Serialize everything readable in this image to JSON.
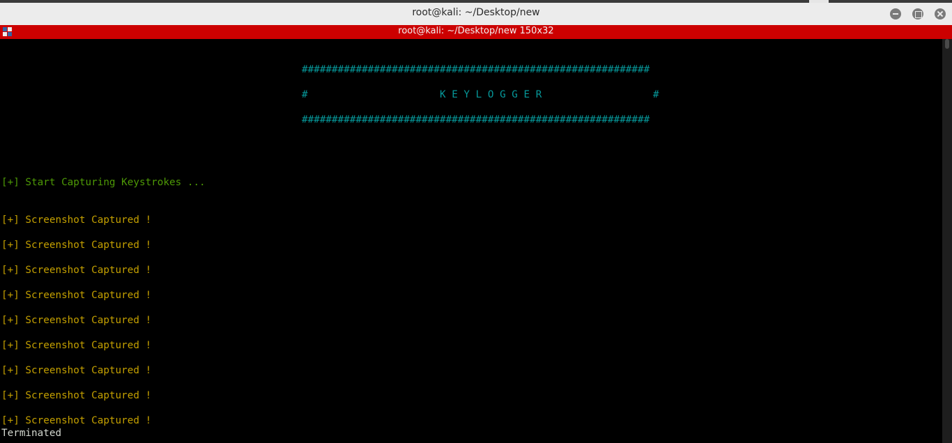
{
  "window": {
    "title": "root@kali: ~/Desktop/new",
    "tab_title": "root@kali: ~/Desktop/new 150x32"
  },
  "terminal": {
    "banner": {
      "top": "##########################################################",
      "left_hash": "#",
      "title": "K E Y L O G G E R",
      "right_hash": "#",
      "bottom": "##########################################################"
    },
    "start_line": "[+] Start Capturing Keystrokes ...",
    "captures": [
      "[+] Screenshot Captured !",
      "[+] Screenshot Captured !",
      "[+] Screenshot Captured !",
      "[+] Screenshot Captured !",
      "[+] Screenshot Captured !",
      "[+] Screenshot Captured !",
      "[+] Screenshot Captured !",
      "[+] Screenshot Captured !",
      "[+] Screenshot Captured !"
    ],
    "terminated": "Terminated"
  },
  "colors": {
    "tab_bar": "#cc0000",
    "banner": "#06989a",
    "start_line": "#4e9a06",
    "capture_line": "#c4a000"
  },
  "icons": {
    "terminal_tab_icon": "terminal-menu-icon",
    "minimize": "minimize-icon",
    "maximize": "maximize-icon",
    "close": "close-icon"
  }
}
